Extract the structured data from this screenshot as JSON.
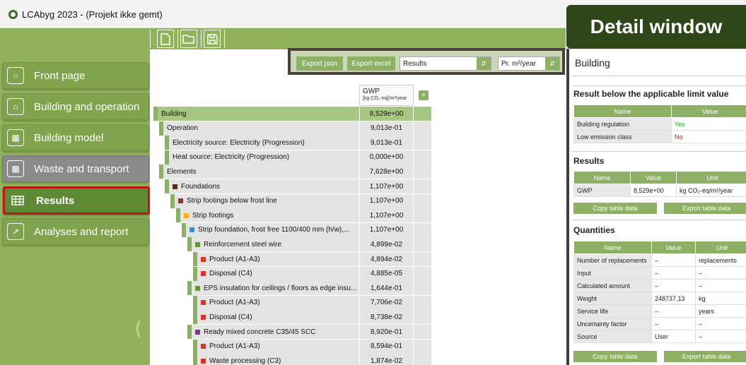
{
  "app": {
    "title": "LCAbyg 2023 - (Projekt ikke gemt)"
  },
  "toolbar": {
    "icons": [
      "new-file-icon",
      "open-folder-icon",
      "save-icon"
    ]
  },
  "nav": [
    {
      "label": "Front page",
      "icon": "front-page-icon"
    },
    {
      "label": "Building and operation",
      "icon": "building-icon"
    },
    {
      "label": "Building model",
      "icon": "building-model-icon"
    },
    {
      "label": "Waste and transport",
      "icon": "truck-icon"
    },
    {
      "label": "Results",
      "icon": "table-icon"
    },
    {
      "label": "Analyses and report",
      "icon": "chart-icon"
    }
  ],
  "export": {
    "json": "Export json",
    "excel": "Export excel",
    "view_select": "Results",
    "unit_select": "Pr. m²/year"
  },
  "table": {
    "col_title": "GWP",
    "col_unit": "[kg CO₂-eq]/m²/year",
    "add": "+"
  },
  "rows": [
    {
      "label": "Building",
      "value": "8,529e+00",
      "indent": 0,
      "icon": "",
      "top": true
    },
    {
      "label": "Operation",
      "value": "9,013e-01",
      "indent": 1,
      "icon": ""
    },
    {
      "label": "Electricity source: Electricity (Progression)",
      "value": "9,013e-01",
      "indent": 2,
      "icon": ""
    },
    {
      "label": "Heat source: Electricity (Progression)",
      "value": "0,000e+00",
      "indent": 2,
      "icon": ""
    },
    {
      "label": "Elements",
      "value": "7,628e+00",
      "indent": 1,
      "icon": ""
    },
    {
      "label": "Foundations",
      "value": "1,107e+00",
      "indent": 2,
      "icon": "#5a2b1a"
    },
    {
      "label": "Strip footings below frost line",
      "value": "1,107e+00",
      "indent": 3,
      "icon": "#8a3a2a"
    },
    {
      "label": "Strip footings",
      "value": "1,107e+00",
      "indent": 4,
      "icon": "#f2b01e"
    },
    {
      "label": "Strip foundation, frost free 1100/400 mm (h/w),...",
      "value": "1,107e+00",
      "indent": 5,
      "icon": "#4a8ac4"
    },
    {
      "label": "Reinforcement steel wire",
      "value": "4,899e-02",
      "indent": 6,
      "icon": "#5a9a2a"
    },
    {
      "label": "Product (A1-A3)",
      "value": "4,894e-02",
      "indent": 7,
      "icon": "#d7342a"
    },
    {
      "label": "Disposal (C4)",
      "value": "4,885e-05",
      "indent": 7,
      "icon": "#d7342a"
    },
    {
      "label": "EPS insulation for ceilings / floors as edge insu...",
      "value": "1,644e-01",
      "indent": 6,
      "icon": "#5a9a2a"
    },
    {
      "label": "Product (A1-A3)",
      "value": "7,706e-02",
      "indent": 7,
      "icon": "#d7342a"
    },
    {
      "label": "Disposal (C4)",
      "value": "8,738e-02",
      "indent": 7,
      "icon": "#d7342a"
    },
    {
      "label": "Ready mixed concrete C35/45 SCC",
      "value": "8,920e-01",
      "indent": 6,
      "icon": "#7a3a8a"
    },
    {
      "label": "Product (A1-A3)",
      "value": "8,594e-01",
      "indent": 7,
      "icon": "#d7342a"
    },
    {
      "label": "Waste processing (C3)",
      "value": "1,874e-02",
      "indent": 7,
      "icon": "#d7342a"
    }
  ],
  "detail": {
    "header": "Detail window",
    "title": "Building",
    "limit_title": "Result below the applicable limit value",
    "limit_cols": [
      "Name",
      "Value"
    ],
    "limit_rows": [
      [
        "Building regulation",
        "Yes"
      ],
      [
        "Low emission class",
        "No"
      ]
    ],
    "results_title": "Results",
    "results_cols": [
      "Name",
      "Value",
      "Unit"
    ],
    "results_rows": [
      [
        "GWP",
        "8,529e+00",
        "kg CO₂-eq/m²/year"
      ]
    ],
    "copy": "Copy table data",
    "export": "Export table data",
    "quant_title": "Quantities",
    "quant_cols": [
      "Name",
      "Value",
      "Unit"
    ],
    "quant_rows": [
      [
        "Number of replacements",
        "–",
        "replacements"
      ],
      [
        "Input",
        "–",
        "–"
      ],
      [
        "Calculated amount",
        "–",
        "–"
      ],
      [
        "Weight",
        "248737,13",
        "kg"
      ],
      [
        "Service life",
        "–",
        "years"
      ],
      [
        "Uncertainty factor",
        "–",
        "–"
      ],
      [
        "Source",
        "User",
        "–"
      ]
    ]
  },
  "colors": {
    "accent": "#8db064",
    "sidebar": "#8fb25b",
    "detail_header": "#2f4718",
    "yes": "#1a9a1a",
    "no": "#d21a1a"
  }
}
